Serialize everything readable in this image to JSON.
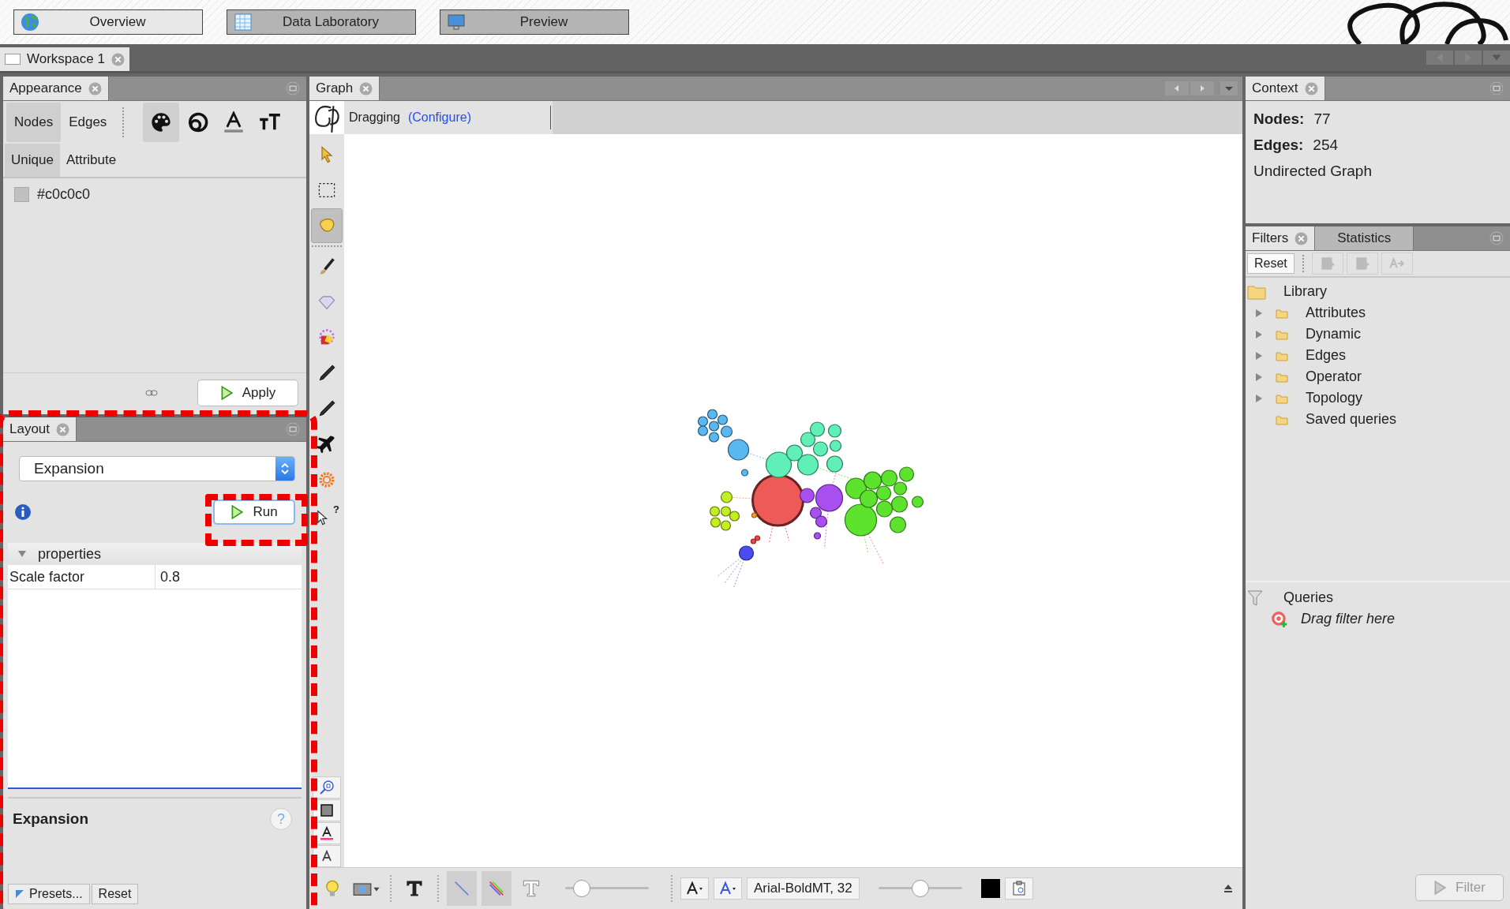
{
  "top_buttons": [
    {
      "label": "Overview",
      "selected": true,
      "kind": "globe"
    },
    {
      "label": "Data Laboratory",
      "selected": false,
      "kind": "table"
    },
    {
      "label": "Preview",
      "selected": false,
      "kind": "monitor"
    }
  ],
  "workspace_tabs": [
    {
      "label": "Workspace 1",
      "selected": true
    }
  ],
  "appearance": {
    "title": "Appearance",
    "element_tabs": [
      {
        "label": "Nodes",
        "selected": true
      },
      {
        "label": "Edges",
        "selected": false
      }
    ],
    "property_tabs": [
      {
        "kind": "color",
        "selected": true
      },
      {
        "kind": "size",
        "selected": false
      },
      {
        "kind": "label-color",
        "selected": false
      },
      {
        "kind": "label-size",
        "selected": false
      }
    ],
    "mode_tabs": [
      {
        "label": "Unique",
        "selected": true
      },
      {
        "label": "Attribute",
        "selected": false
      }
    ],
    "color_value": "#c0c0c0",
    "apply_button": "Apply"
  },
  "layout": {
    "title": "Layout",
    "algorithm": "Expansion",
    "run_button": "Run",
    "section": "properties",
    "section_expanded": true,
    "properties": [
      {
        "name": "Scale factor",
        "value": "0.8"
      }
    ],
    "description_title": "Expansion",
    "help_glyph": "?",
    "presets_button": "Presets...",
    "reset_button": "Reset"
  },
  "graph": {
    "title": "Graph",
    "tool_name": "Dragging",
    "configure_link": "(Configure)",
    "tools": [
      {
        "kind": "pointer",
        "selected": false
      },
      {
        "kind": "rect-select",
        "selected": false
      },
      {
        "kind": "hand",
        "selected": true
      },
      {
        "kind": "separator"
      },
      {
        "kind": "brush",
        "selected": false
      },
      {
        "kind": "diamond",
        "selected": false
      },
      {
        "kind": "bucket",
        "selected": false
      },
      {
        "kind": "pencil",
        "selected": false
      },
      {
        "kind": "pencil",
        "selected": false
      },
      {
        "kind": "airplane",
        "selected": false
      },
      {
        "kind": "gear",
        "selected": false
      },
      {
        "kind": "help-cursor",
        "selected": false,
        "glyph": "?"
      }
    ],
    "side_buttons": [
      {
        "kind": "zoom-fit"
      },
      {
        "kind": "square"
      },
      {
        "kind": "letter-underlined"
      },
      {
        "kind": "letter"
      }
    ],
    "bottom_tools": [
      {
        "kind": "bulb",
        "selected": false
      },
      {
        "kind": "camera",
        "selected": false
      },
      {
        "kind": "text-bold",
        "selected": false
      },
      {
        "kind": "edges",
        "selected": true
      },
      {
        "kind": "edge-color",
        "selected": true
      },
      {
        "kind": "text-outline",
        "selected": false
      }
    ],
    "label_size_slider": {
      "level": 0.2
    },
    "font": "Arial-BoldMT, 32",
    "edge_scale_slider": {
      "level": 0.5
    }
  },
  "context": {
    "title": "Context",
    "stats": [
      {
        "label": "Nodes:",
        "value": "77"
      },
      {
        "label": "Edges:",
        "value": "254"
      }
    ],
    "graph_type": "Undirected Graph"
  },
  "filters": {
    "tabs": [
      {
        "label": "Filters",
        "selected": true
      },
      {
        "label": "Statistics",
        "selected": false
      }
    ],
    "reset_button": "Reset",
    "library": {
      "label": "Library",
      "children": [
        {
          "label": "Attributes",
          "expandable": true
        },
        {
          "label": "Dynamic",
          "expandable": true
        },
        {
          "label": "Edges",
          "expandable": true
        },
        {
          "label": "Operator",
          "expandable": true
        },
        {
          "label": "Topology",
          "expandable": true
        },
        {
          "label": "Saved queries",
          "expandable": false
        }
      ]
    },
    "queries": {
      "label": "Queries",
      "placeholder": "Drag filter here"
    },
    "filter_button": {
      "label": "Filter",
      "disabled": true
    }
  }
}
